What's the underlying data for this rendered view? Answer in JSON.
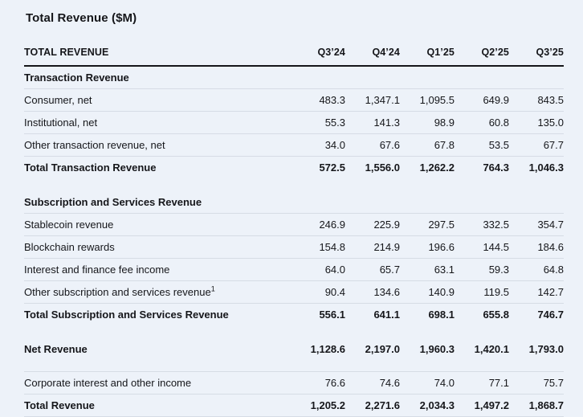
{
  "page": {
    "title": "Total Revenue ($M)"
  },
  "theme": {
    "background": "#edf2f9",
    "text": "#15161a",
    "thin_rule": "#d6dce5",
    "thick_rule": "#15161a"
  },
  "table": {
    "header": {
      "label": "TOTAL REVENUE",
      "quarters": [
        "Q3’24",
        "Q4’24",
        "Q1’25",
        "Q2’25",
        "Q3’25"
      ]
    },
    "rows": [
      {
        "type": "section",
        "label": "Transaction Revenue"
      },
      {
        "type": "data",
        "label": "Consumer, net",
        "values": [
          "483.3",
          "1,347.1",
          "1,095.5",
          "649.9",
          "843.5"
        ]
      },
      {
        "type": "data",
        "label": "Institutional, net",
        "values": [
          "55.3",
          "141.3",
          "98.9",
          "60.8",
          "135.0"
        ]
      },
      {
        "type": "data",
        "label": "Other transaction revenue, net",
        "values": [
          "34.0",
          "67.6",
          "67.8",
          "53.5",
          "67.7"
        ]
      },
      {
        "type": "total",
        "label": "Total Transaction Revenue",
        "values": [
          "572.5",
          "1,556.0",
          "1,262.2",
          "764.3",
          "1,046.3"
        ]
      },
      {
        "type": "spacer"
      },
      {
        "type": "section",
        "label": "Subscription and Services Revenue"
      },
      {
        "type": "data",
        "label": "Stablecoin revenue",
        "values": [
          "246.9",
          "225.9",
          "297.5",
          "332.5",
          "354.7"
        ]
      },
      {
        "type": "data",
        "label": "Blockchain rewards",
        "values": [
          "154.8",
          "214.9",
          "196.6",
          "144.5",
          "184.6"
        ]
      },
      {
        "type": "data",
        "label": "Interest and finance fee income",
        "values": [
          "64.0",
          "65.7",
          "63.1",
          "59.3",
          "64.8"
        ]
      },
      {
        "type": "data",
        "label": "Other subscription and services revenue",
        "sup": "1",
        "values": [
          "90.4",
          "134.6",
          "140.9",
          "119.5",
          "142.7"
        ]
      },
      {
        "type": "total",
        "label": "Total Subscription and Services Revenue",
        "values": [
          "556.1",
          "641.1",
          "698.1",
          "655.8",
          "746.7"
        ]
      },
      {
        "type": "spacer"
      },
      {
        "type": "total",
        "label": "Net Revenue",
        "values": [
          "1,128.6",
          "2,197.0",
          "1,960.3",
          "1,420.1",
          "1,793.0"
        ]
      },
      {
        "type": "spacer-line"
      },
      {
        "type": "data",
        "label": "Corporate interest and other income",
        "values": [
          "76.6",
          "74.6",
          "74.0",
          "77.1",
          "75.7"
        ]
      },
      {
        "type": "grand-total",
        "label": "Total Revenue",
        "values": [
          "1,205.2",
          "2,271.6",
          "2,034.3",
          "1,497.2",
          "1,868.7"
        ]
      }
    ]
  }
}
